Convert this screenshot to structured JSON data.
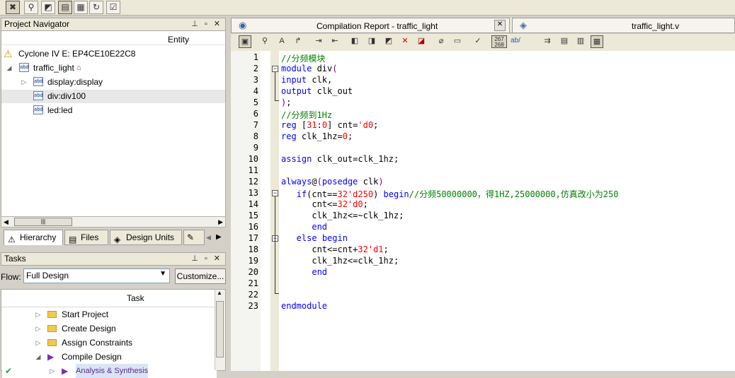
{
  "toolbar": {
    "buttons": [
      "programmer-icon",
      "binoculars-icon",
      "rtl-viewer-icon",
      "pin-planner-icon",
      "chip-planner-icon",
      "refresh-icon",
      "checklist-icon"
    ]
  },
  "navigator": {
    "title": "Project Navigator",
    "ctrls": "ᵽ ▫ ✕",
    "column": "Entity",
    "device": "Cyclone IV E: EP4CE10E22C8",
    "tree": [
      {
        "label": "traffic_light",
        "level": 0
      },
      {
        "label": "display:display",
        "level": 1
      },
      {
        "label": "div:div100",
        "level": 1
      },
      {
        "label": "led:led",
        "level": 1
      }
    ],
    "tabs": [
      "Hierarchy",
      "Files",
      "Design Units"
    ]
  },
  "tasks": {
    "title": "Tasks",
    "flow_label": "Flow:",
    "flow_value": "Full Design",
    "customize": "Customize...",
    "column": "Task",
    "items": [
      "Start Project",
      "Create Design",
      "Assign Constraints",
      "Compile Design",
      "Analysis & Synthesis"
    ]
  },
  "editor": {
    "tab_report": "Compilation Report - traffic_light",
    "tab_file": "traffic_light.v",
    "hex_label_top": "267",
    "hex_label_bottom": "268",
    "ab_label": "ab/",
    "lines": [
      {
        "n": "1",
        "segs": [
          {
            "t": "//分频模块",
            "c": "cmt"
          }
        ]
      },
      {
        "n": "2",
        "segs": [
          {
            "t": "module",
            "c": "kw"
          },
          {
            "t": " div",
            "c": ""
          },
          {
            "t": "(",
            "c": "par"
          }
        ]
      },
      {
        "n": "3",
        "segs": [
          {
            "t": "input",
            "c": "kw"
          },
          {
            "t": " clk,",
            "c": ""
          }
        ]
      },
      {
        "n": "4",
        "segs": [
          {
            "t": "output",
            "c": "kw"
          },
          {
            "t": " clk_out",
            "c": ""
          }
        ]
      },
      {
        "n": "5",
        "segs": [
          {
            "t": ")",
            "c": "par"
          },
          {
            "t": ";",
            "c": ""
          }
        ]
      },
      {
        "n": "6",
        "segs": [
          {
            "t": "//分频到1Hz",
            "c": "cmt"
          }
        ]
      },
      {
        "n": "7",
        "segs": [
          {
            "t": "reg",
            "c": "kw"
          },
          {
            "t": " [",
            "c": ""
          },
          {
            "t": "31",
            "c": "num"
          },
          {
            "t": ":",
            "c": ""
          },
          {
            "t": "0",
            "c": "num"
          },
          {
            "t": "] cnt=",
            "c": ""
          },
          {
            "t": "'d0",
            "c": "num"
          },
          {
            "t": ";",
            "c": ""
          }
        ]
      },
      {
        "n": "8",
        "segs": [
          {
            "t": "reg",
            "c": "kw"
          },
          {
            "t": " clk_1hz=",
            "c": ""
          },
          {
            "t": "0",
            "c": "num"
          },
          {
            "t": ";",
            "c": ""
          }
        ]
      },
      {
        "n": "9",
        "segs": []
      },
      {
        "n": "10",
        "segs": [
          {
            "t": "assign",
            "c": "kw"
          },
          {
            "t": " clk_out=clk_1hz;",
            "c": ""
          }
        ]
      },
      {
        "n": "11",
        "segs": []
      },
      {
        "n": "12",
        "segs": [
          {
            "t": "always",
            "c": "kw"
          },
          {
            "t": "@",
            "c": ""
          },
          {
            "t": "(",
            "c": "par"
          },
          {
            "t": "posedge",
            "c": "kw"
          },
          {
            "t": " clk",
            "c": ""
          },
          {
            "t": ")",
            "c": "par"
          }
        ]
      },
      {
        "n": "13",
        "segs": [
          {
            "t": "   if",
            "c": "kw"
          },
          {
            "t": "(cnt==",
            "c": ""
          },
          {
            "t": "32'd250",
            "c": "num"
          },
          {
            "t": ") ",
            "c": ""
          },
          {
            "t": "begin",
            "c": "kw"
          },
          {
            "t": "//分频50000000，得1HZ,25000000,仿真改小为250",
            "c": "cmt"
          }
        ]
      },
      {
        "n": "14",
        "segs": [
          {
            "t": "      cnt<=",
            "c": ""
          },
          {
            "t": "32'd0",
            "c": "num"
          },
          {
            "t": ";",
            "c": ""
          }
        ]
      },
      {
        "n": "15",
        "segs": [
          {
            "t": "      clk_1hz<=~clk_1hz;",
            "c": ""
          }
        ]
      },
      {
        "n": "16",
        "segs": [
          {
            "t": "      end",
            "c": "kw"
          }
        ]
      },
      {
        "n": "17",
        "segs": [
          {
            "t": "   else",
            "c": "kw"
          },
          {
            "t": " ",
            "c": ""
          },
          {
            "t": "begin",
            "c": "kw"
          }
        ]
      },
      {
        "n": "18",
        "segs": [
          {
            "t": "      cnt<=cnt+",
            "c": ""
          },
          {
            "t": "32'd1",
            "c": "num"
          },
          {
            "t": ";",
            "c": ""
          }
        ]
      },
      {
        "n": "19",
        "segs": [
          {
            "t": "      clk_1hz<=clk_1hz;",
            "c": ""
          }
        ]
      },
      {
        "n": "20",
        "segs": [
          {
            "t": "      end",
            "c": "kw"
          }
        ]
      },
      {
        "n": "21",
        "segs": []
      },
      {
        "n": "22",
        "segs": []
      },
      {
        "n": "23",
        "segs": [
          {
            "t": "endmodule",
            "c": "kw"
          }
        ]
      }
    ]
  }
}
